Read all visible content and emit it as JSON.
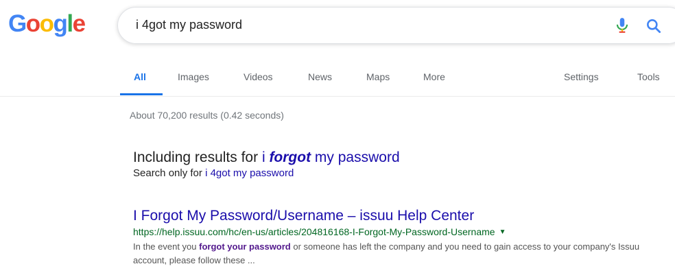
{
  "logo": {
    "letters": [
      "G",
      "o",
      "o",
      "g",
      "l",
      "e"
    ],
    "colors": [
      "#4285F4",
      "#EA4335",
      "#FBBC05",
      "#4285F4",
      "#34A853",
      "#EA4335"
    ]
  },
  "search": {
    "query": "i 4got my password"
  },
  "icons": {
    "mic": "microphone-icon",
    "search": "search-icon"
  },
  "tabs": {
    "all": "All",
    "images": "Images",
    "videos": "Videos",
    "news": "News",
    "maps": "Maps",
    "more": "More",
    "settings": "Settings",
    "tools": "Tools"
  },
  "stats": "About 70,200 results (0.42 seconds)",
  "correction": {
    "including_prefix": "Including results for ",
    "corrected_q1": "i ",
    "corrected_bold": "forgot",
    "corrected_q3": " my password",
    "only_prefix": "Search only for ",
    "original_query": "i 4got my password"
  },
  "results": [
    {
      "title": "I Forgot My Password/Username – issuu Help Center",
      "url": "https://help.issuu.com/hc/en-us/articles/204816168-I-Forgot-My-Password-Username",
      "snippet_pre": "In the event you ",
      "snippet_bold": "forgot your password",
      "snippet_post": " or someone has left the company and you need to gain access to your company's Issuu account, please follow these ..."
    }
  ],
  "colors": {
    "link": "#1a0dab",
    "url": "#006621",
    "accent": "#1a73e8"
  }
}
